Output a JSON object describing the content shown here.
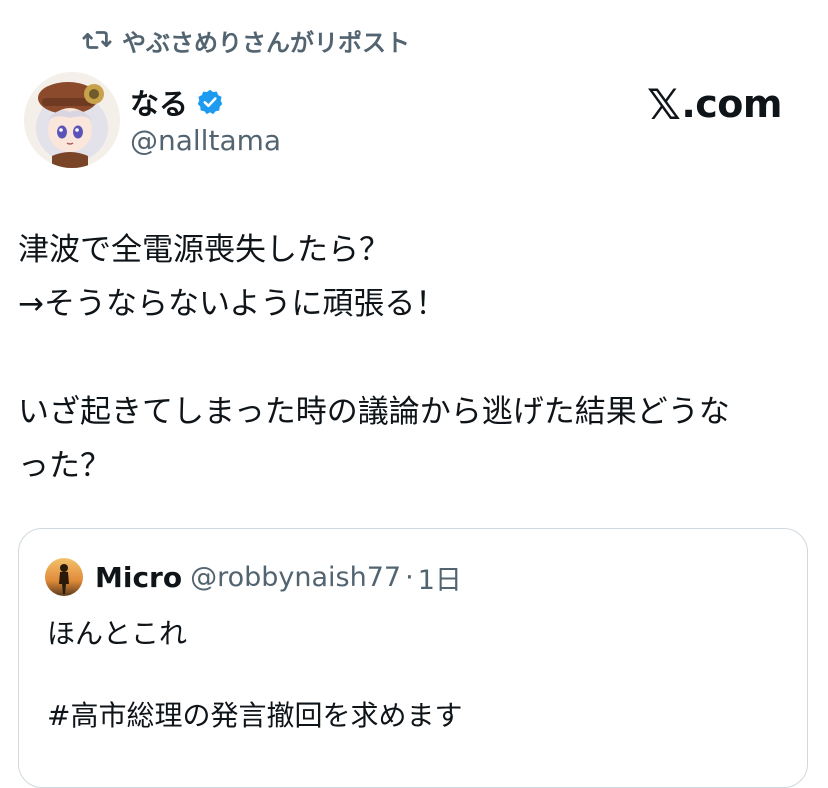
{
  "repost": {
    "icon": "repost-icon",
    "label": "やぶさめりさんがリポスト"
  },
  "author": {
    "name": "なる",
    "handle": "@nalltama",
    "verified_icon": "verified-badge-icon",
    "verified_color": "#1d9bf0"
  },
  "brand": {
    "x_mark": "𝕏",
    "label": ".com"
  },
  "tweet": {
    "lines": [
      "津波で全電源喪失したら？",
      "→そうならないように頑張る！",
      "",
      "いざ起きてしまった時の議論から逃げた結果どうな",
      "った？"
    ]
  },
  "quote": {
    "name": "Micro",
    "handle": "@robbynaish77",
    "separator": "·",
    "time": "1日",
    "lines": [
      "ほんとこれ",
      "",
      "#高市総理の発言撤回を求めます"
    ]
  },
  "colors": {
    "text": "#0f1419",
    "secondary": "#536471",
    "border": "#cfd9de",
    "accent": "#1d9bf0"
  }
}
